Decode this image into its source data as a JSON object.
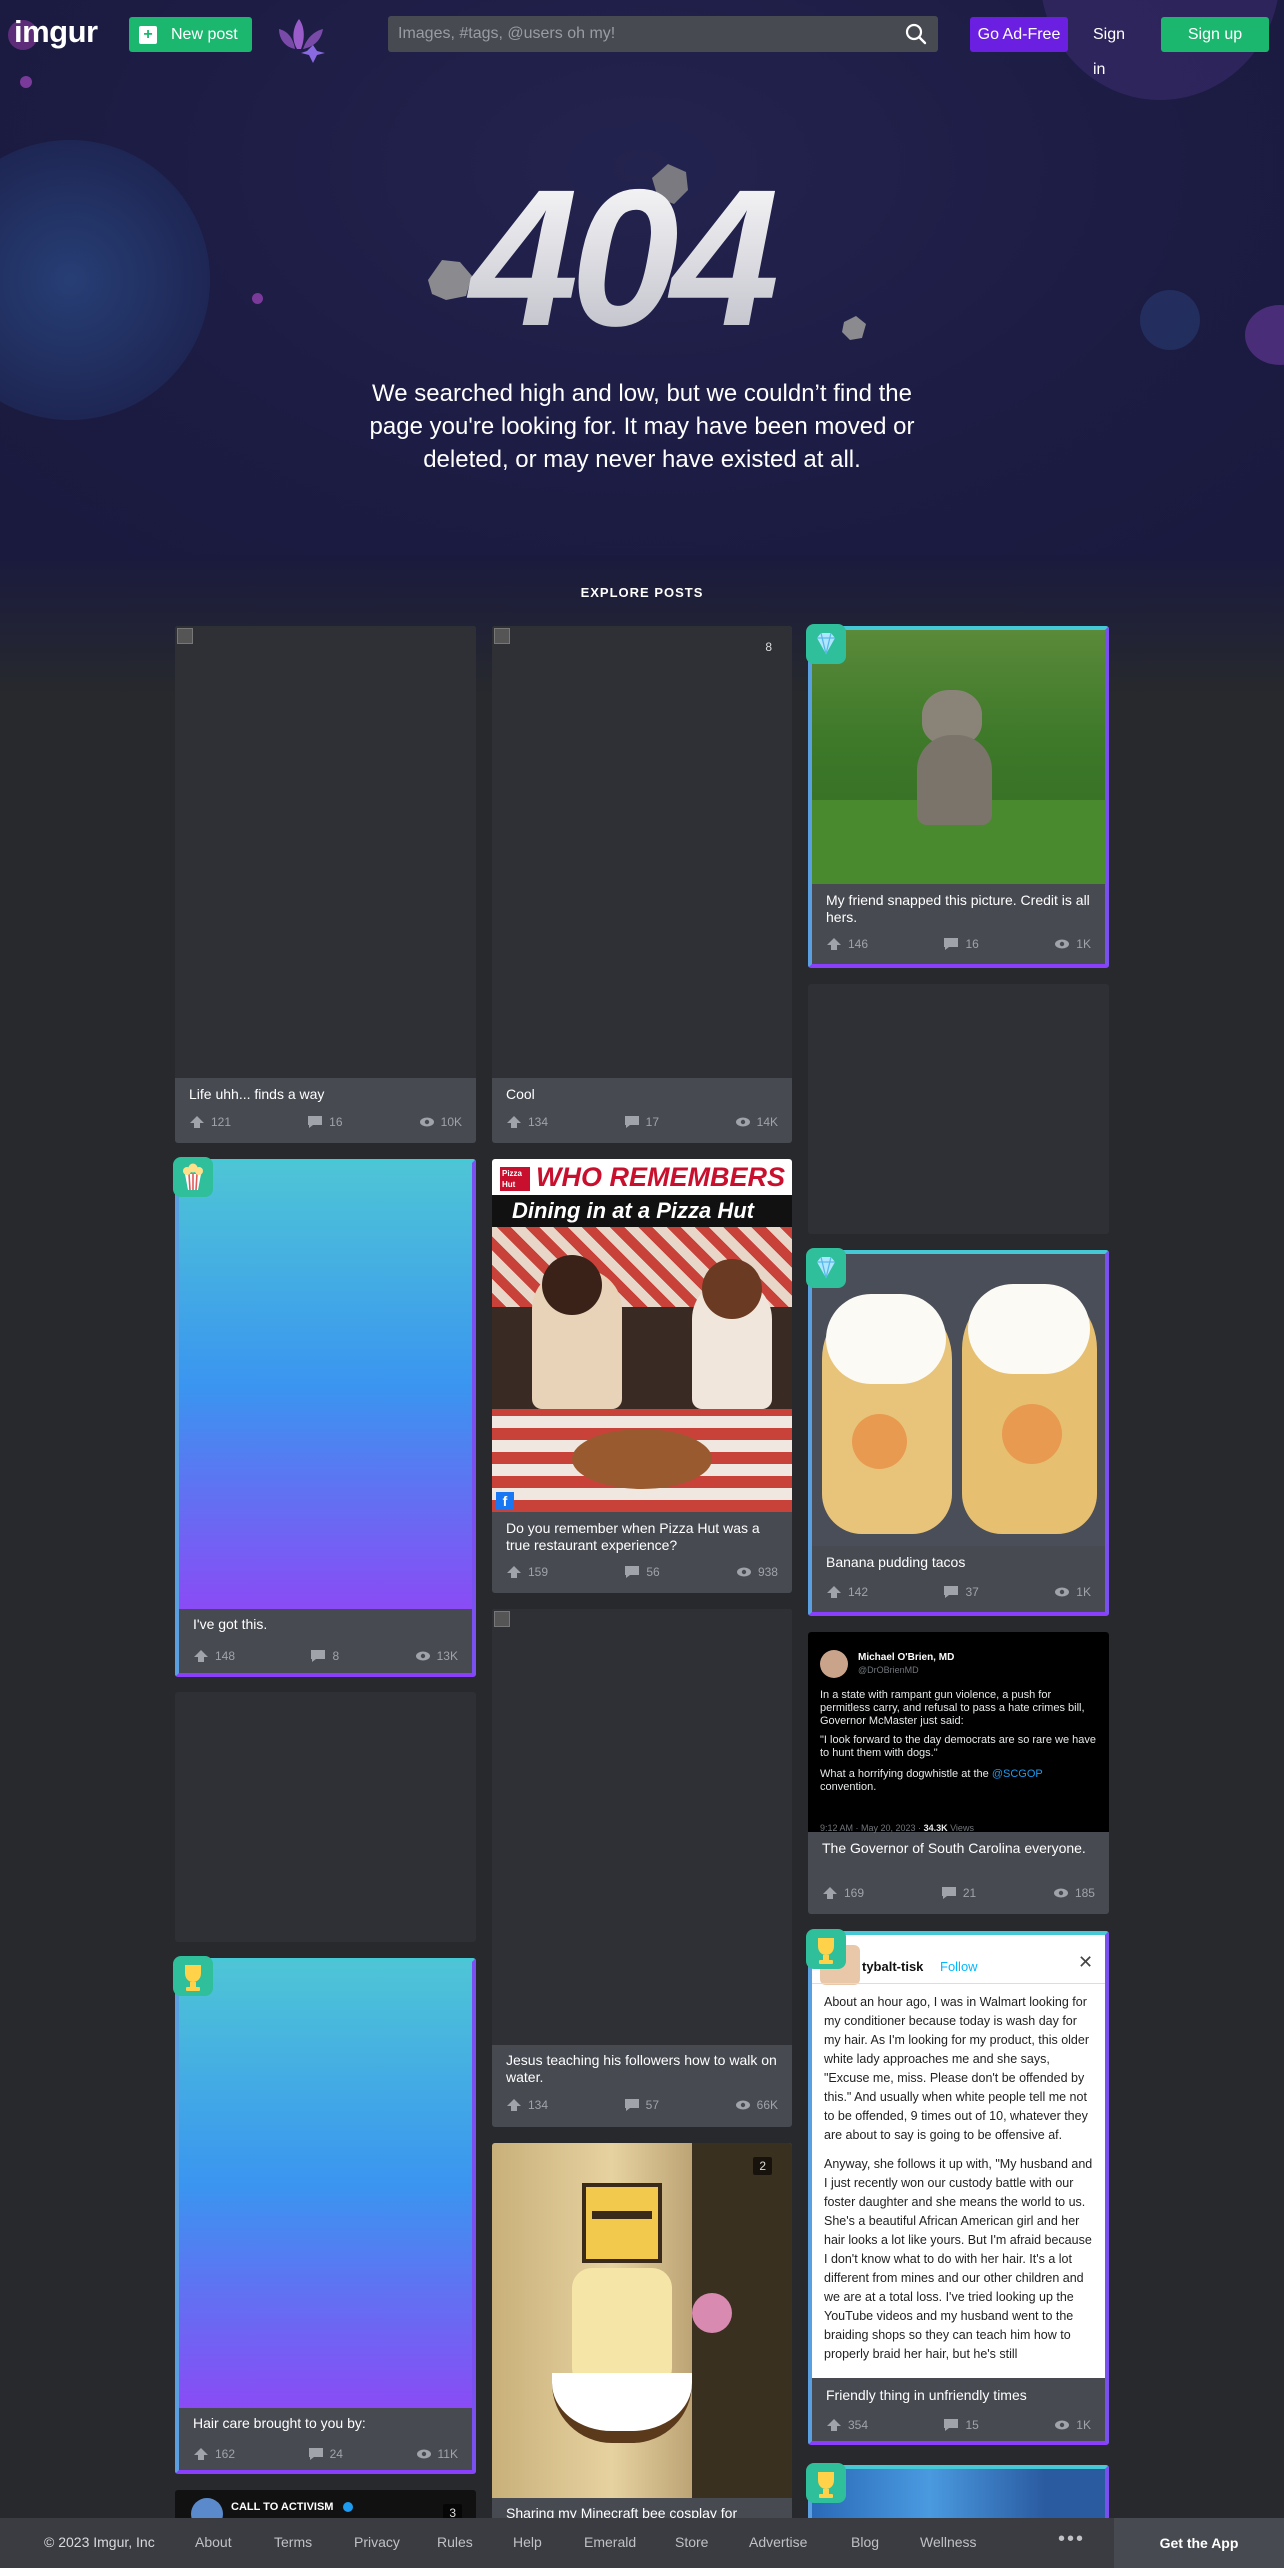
{
  "header": {
    "logo_main": "imgur",
    "new_post": "New post",
    "search_placeholder": "Images, #tags, @users oh my!",
    "ad_free": "Go Ad-Free",
    "sign_in": "Sign in",
    "sign_up": "Sign up"
  },
  "error": {
    "code": "404",
    "message": "We searched high and low, but we couldn’t find the page you're looking for. It may have been moved or deleted, or may never have existed at all."
  },
  "explore_label": "EXPLORE POSTS",
  "posts": [
    {
      "title": "Life uhh... finds a way",
      "upvotes": "121",
      "comments": "16",
      "views": "10K"
    },
    {
      "title": "Cool",
      "upvotes": "134",
      "comments": "17",
      "views": "14K",
      "image_count": "8"
    },
    {
      "title": "My friend snapped this picture. Credit is all hers.",
      "upvotes": "146",
      "comments": "16",
      "views": "1K"
    },
    {
      "title": "I've got this.",
      "upvotes": "148",
      "comments": "8",
      "views": "13K"
    },
    {
      "title": "Do you remember when Pizza Hut was a true restaurant experience?",
      "upvotes": "159",
      "comments": "56",
      "views": "938",
      "image_text_1": "WHO REMEMBERS",
      "image_text_2": "Dining in at a Pizza Hut",
      "image_logo": "Pizza Hut"
    },
    {
      "title": "Banana pudding tacos",
      "upvotes": "142",
      "comments": "37",
      "views": "1K"
    },
    {
      "title": "The Governor of South Carolina everyone.",
      "upvotes": "169",
      "comments": "21",
      "views": "185",
      "tweet": {
        "name": "Michael O'Brien, MD",
        "handle": "@DrOBrienMD",
        "p1": "In a state with rampant gun violence, a push for permitless carry, and refusal to pass a hate crimes bill, Governor McMaster just said:",
        "p2": "\"I look forward to the day democrats are so rare we have to hunt them with dogs.\"",
        "p3a": "What a horrifying dogwhistle at the ",
        "p3link": "@SCGOP",
        "p3b": " convention.",
        "meta": "9:12 AM · May 20, 2023 · ",
        "views_count": "34.3K",
        "views_label": " Views"
      }
    },
    {
      "title": "Jesus teaching his followers how to walk on water.",
      "upvotes": "134",
      "comments": "57",
      "views": "66K"
    },
    {
      "title": "Hair care brought to you by:",
      "upvotes": "162",
      "comments": "24",
      "views": "11K"
    },
    {
      "title": "Friendly thing in unfriendly times",
      "upvotes": "354",
      "comments": "15",
      "views": "1K",
      "note": {
        "user": "tybalt-tisk",
        "follow": "Follow",
        "p1": "About an hour ago, I was in Walmart looking for my conditioner because today is wash day for my hair. As I'm looking for my product, this older white lady approaches me and she says, \"Excuse me, miss. Please don't be offended by this.\" And usually when white people tell me not to be offended, 9 times out of 10, whatever they are about to say is going to be offensive af.",
        "p2": "Anyway, she follows it up with, \"My husband and I just recently won our custody battle with our foster daughter and she means the world to us. She's a beautiful African American girl and her hair looks a lot like yours. But I'm afraid because I don't know what to do with her hair. It's a lot different from mines and our other children and we are at a total loss. I've tried looking up the YouTube videos and my husband went to the braiding shops so they can teach him how to properly braid her hair, but he's still"
      }
    },
    {
      "title": "Sharing my Minecraft bee cosplay for",
      "image_count": "2"
    },
    {
      "title": "CALL TO ACTIVISM",
      "image_count": "3"
    }
  ],
  "footer": {
    "copyright": "© 2023 Imgur, Inc",
    "links": [
      "About",
      "Terms",
      "Privacy",
      "Rules",
      "Help",
      "Emerald",
      "Store",
      "Advertise",
      "Blog",
      "Wellness"
    ],
    "more": "•••",
    "get_app": "Get the App"
  },
  "colors": {
    "green": "#1bb76e",
    "purple": "#6b1fe0",
    "card": "#474a51",
    "page": "#27292d",
    "hero": "#1c1c44"
  }
}
